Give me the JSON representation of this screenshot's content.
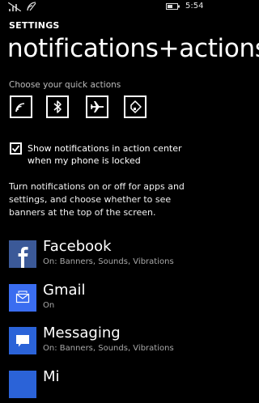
{
  "status_bar": {
    "time": "5:54"
  },
  "header": {
    "label": "SETTINGS",
    "title": "notifications+actions"
  },
  "quick_actions": {
    "label": "Choose your quick actions",
    "items": [
      {
        "icon": "wifi-icon"
      },
      {
        "icon": "bluetooth-icon"
      },
      {
        "icon": "airplane-mode-icon"
      },
      {
        "icon": "location-icon"
      }
    ]
  },
  "lock_option": {
    "checked": true,
    "label": "Show notifications in action center when my phone is locked"
  },
  "description": "Turn notifications on or off for apps and settings, and choose whether to see banners at the top of the screen.",
  "apps": [
    {
      "name": "Facebook",
      "status": "On: Banners, Sounds, Vibrations",
      "color": "#3b5998",
      "icon": "facebook-icon"
    },
    {
      "name": "Gmail",
      "status": "On",
      "color": "#3a6df0",
      "icon": "mail-icon"
    },
    {
      "name": "Messaging",
      "status": "On: Banners, Sounds, Vibrations",
      "color": "#2b63d8",
      "icon": "message-icon"
    },
    {
      "name": "Mi",
      "status": "",
      "color": "#2b63d8",
      "icon": "app-icon"
    }
  ],
  "colors": {
    "background": "#000000",
    "text": "#ffffff",
    "secondary": "#a8a8a8"
  }
}
